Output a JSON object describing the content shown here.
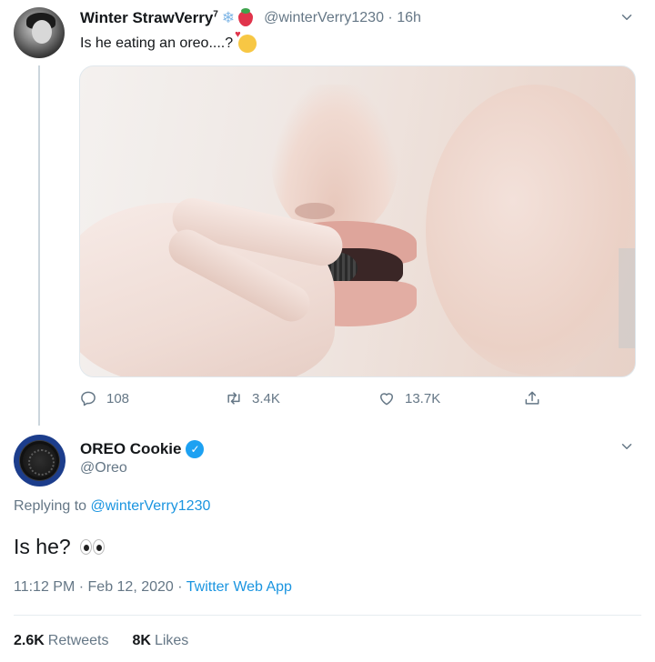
{
  "parent_tweet": {
    "display_name": "Winter StrawVerry",
    "name_superscript": "7",
    "handle": "@winterVerry1230",
    "time": "16h",
    "text": "Is he eating an oreo....?",
    "counts": {
      "replies": "108",
      "retweets": "3.4K",
      "likes": "13.7K"
    }
  },
  "reply_tweet": {
    "display_name": "OREO Cookie",
    "handle": "@Oreo",
    "replying_label": "Replying to",
    "replying_handle": "@winterVerry1230",
    "text": "Is he?",
    "timestamp": "11:12 PM · Feb 12, 2020",
    "separator": "·",
    "source": "Twitter Web App",
    "retweets_count": "2.6K",
    "retweets_label": "Retweets",
    "likes_count": "8K",
    "likes_label": "Likes"
  },
  "icons": {
    "reply": "reply-icon",
    "retweet": "retweet-icon",
    "like": "heart-icon",
    "share": "share-icon",
    "more": "chevron-down-icon",
    "verified": "verified-badge-icon"
  },
  "colors": {
    "link": "#1b95e0",
    "secondary_text": "#657786",
    "primary_text": "#14171a",
    "verified": "#1da1f2"
  }
}
